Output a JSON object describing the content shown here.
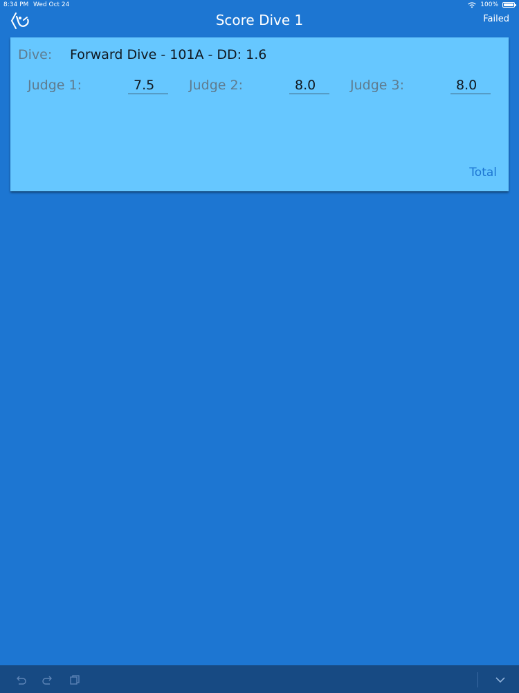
{
  "status_bar": {
    "time": "8:34 PM",
    "date": "Wed Oct 24",
    "battery": "100%"
  },
  "nav": {
    "title": "Score Dive 1",
    "right_action": "Failed"
  },
  "card": {
    "dive_label": "Dive:",
    "dive_name": "Forward Dive - 101A - DD: 1.6",
    "judges": [
      {
        "label": "Judge 1:",
        "score": "7.5"
      },
      {
        "label": "Judge 2:",
        "score": "8.0"
      },
      {
        "label": "Judge 3:",
        "score": "8.0"
      }
    ],
    "total_label": "Total"
  },
  "toolbar": {
    "icons": [
      "undo-icon",
      "redo-icon",
      "copy-icon",
      "chevron-down-icon"
    ]
  },
  "colors": {
    "background": "#1d76d2",
    "card": "#66c7ff",
    "toolbar": "#174a83"
  }
}
